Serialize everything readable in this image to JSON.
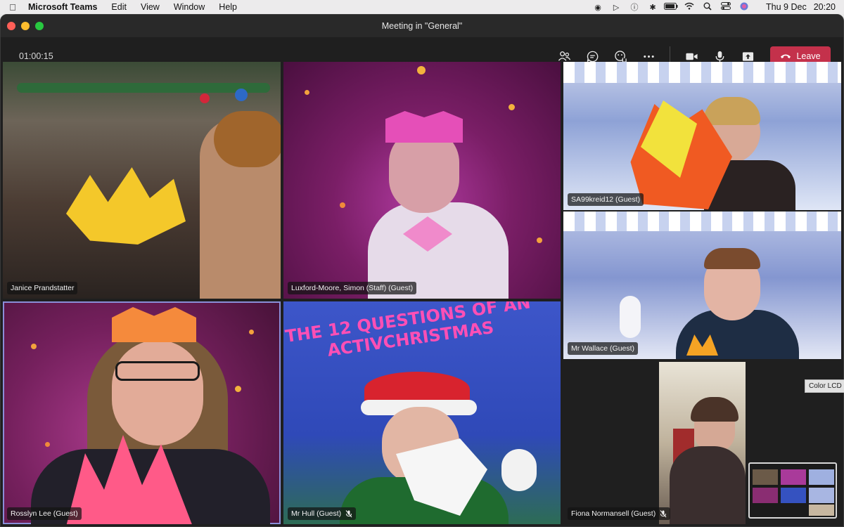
{
  "menubar": {
    "app_name": "Microsoft Teams",
    "menus": [
      "Edit",
      "View",
      "Window",
      "Help"
    ],
    "status_icons": [
      "creative-cloud-icon",
      "play-icon",
      "info-icon",
      "bluetooth-icon",
      "battery-icon",
      "wifi-icon",
      "search-icon",
      "control-center-icon",
      "siri-icon"
    ],
    "date": "Thu 9 Dec",
    "time": "20:20"
  },
  "window": {
    "title": "Meeting in \"General\""
  },
  "toolbar": {
    "timer": "01:00:15",
    "leave_label": "Leave",
    "leave_color": "#c4314b"
  },
  "participants": [
    {
      "name": "Janice Prandstatter",
      "muted": false
    },
    {
      "name": "Luxford-Moore, Simon (Staff) (Guest)",
      "muted": false
    },
    {
      "name": "SA99kreid12 (Guest)",
      "muted": false
    },
    {
      "name": "Mr Wallace (Guest)",
      "muted": false
    },
    {
      "name": "Rosslyn Lee (Guest)",
      "muted": false,
      "active_speaker": true
    },
    {
      "name": "Mr Hull (Guest)",
      "muted": true
    },
    {
      "name": "Fiona Normansell (Guest)",
      "muted": true
    }
  ],
  "hull_background_text": "THE 12 QUESTIONS OF AN ACTIVCHRISTMAS",
  "tooltip": "Color LCD"
}
